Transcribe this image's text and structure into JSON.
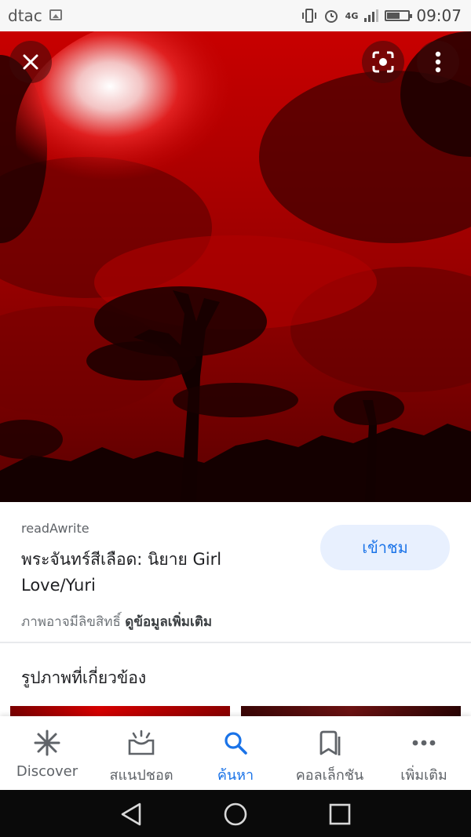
{
  "status_bar": {
    "carrier": "dtac",
    "network": "4G",
    "time": "09:07"
  },
  "viewer": {
    "image_icons": {
      "close": "close-icon",
      "lens": "lens-icon",
      "more": "more-vert-icon"
    }
  },
  "result": {
    "source": "readAwrite",
    "title": "พระจันทร์สีเลือด: นิยาย Girl Love/Yuri",
    "visit_label": "เข้าชม",
    "copyright_text": "ภาพอาจมีลิขสิทธิ์",
    "more_info_label": "ดูข้อมูลเพิ่มเติม"
  },
  "related": {
    "title": "รูปภาพที่เกี่ยวข้อง"
  },
  "bottom_nav": {
    "items": [
      {
        "label": "Discover",
        "icon": "asterisk-icon"
      },
      {
        "label": "สแนปชอต",
        "icon": "snapshot-icon"
      },
      {
        "label": "ค้นหา",
        "icon": "search-icon",
        "active": true
      },
      {
        "label": "คอลเล็กชัน",
        "icon": "collections-icon"
      },
      {
        "label": "เพิ่มเติม",
        "icon": "more-horiz-icon"
      }
    ]
  },
  "colors": {
    "accent": "#1a73e8",
    "accent_bg": "#e8f0fe",
    "image_red": "#c40000"
  }
}
